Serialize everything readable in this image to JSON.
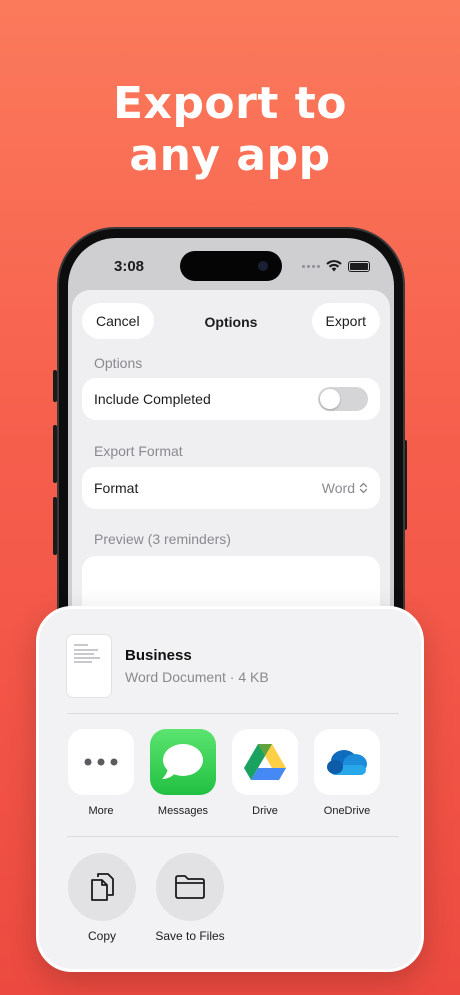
{
  "headline": {
    "line1": "Export to",
    "line2": "any app"
  },
  "status_bar": {
    "time": "3:08"
  },
  "options_sheet": {
    "cancel_label": "Cancel",
    "title": "Options",
    "export_label": "Export",
    "options_section": "Options",
    "include_completed_label": "Include Completed",
    "include_completed_on": false,
    "export_format_section": "Export Format",
    "format_label": "Format",
    "format_value": "Word",
    "preview_section": "Preview (3 reminders)"
  },
  "share_sheet": {
    "doc_name": "Business",
    "doc_meta": "Word Document · 4 KB",
    "apps": [
      {
        "label": "More",
        "icon": "more-icon"
      },
      {
        "label": "Messages",
        "icon": "messages-icon"
      },
      {
        "label": "Drive",
        "icon": "google-drive-icon"
      },
      {
        "label": "OneDrive",
        "icon": "onedrive-icon"
      }
    ],
    "actions": [
      {
        "label": "Copy",
        "icon": "copy-icon"
      },
      {
        "label": "Save to Files",
        "icon": "folder-icon"
      }
    ]
  },
  "colors": {
    "background_top": "#fb7a5c",
    "background_bottom": "#ec4a40",
    "messages_green": "#34c759",
    "onedrive_blue": "#0f6cbd"
  }
}
